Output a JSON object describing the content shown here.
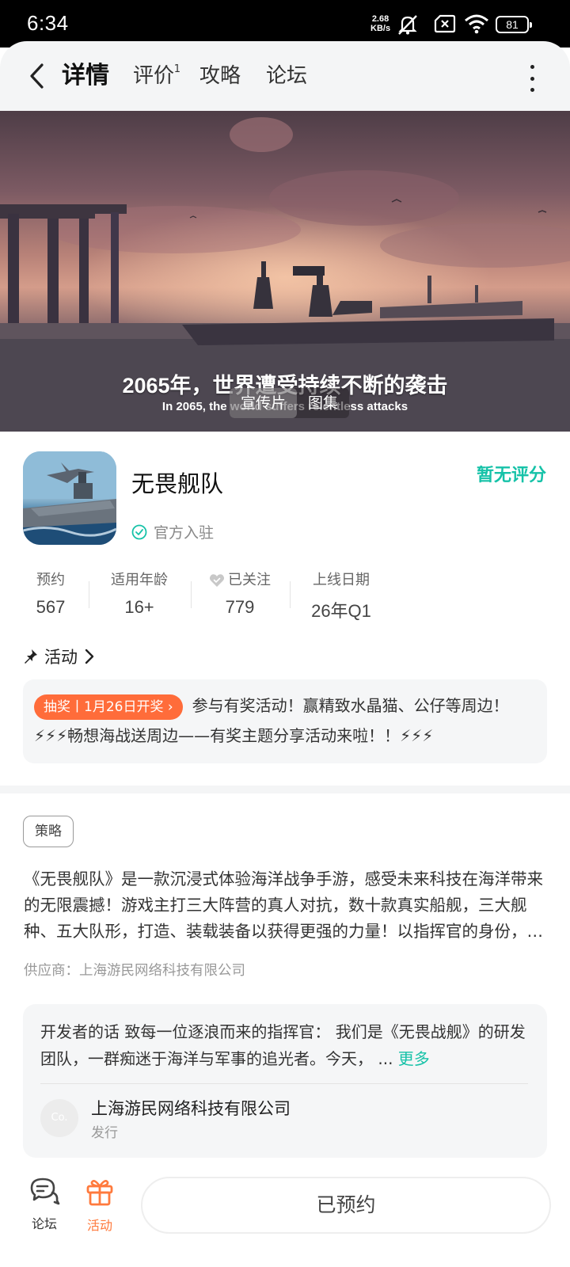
{
  "status_bar": {
    "time": "6:34",
    "net_speed_value": "2.68",
    "net_speed_unit": "KB/s",
    "battery": "81"
  },
  "header": {
    "tabs": [
      {
        "label": "详情",
        "active": true
      },
      {
        "label": "评价",
        "badge": "1"
      },
      {
        "label": "攻略"
      },
      {
        "label": "论坛"
      }
    ]
  },
  "hero": {
    "subtitle_zh": "2065年，世界遭受持续不断的袭击",
    "subtitle_en": "In 2065, the world suffers relentless attacks",
    "media_tabs": [
      "宣传片",
      "图集"
    ]
  },
  "game": {
    "name": "无畏舰队",
    "official_label": "官方入驻",
    "rating_text": "暂无评分"
  },
  "stats": [
    {
      "label": "预约",
      "value": "567"
    },
    {
      "label": "适用年龄",
      "value": "16+"
    },
    {
      "label": "已关注",
      "value": "779",
      "icon": "heart-icon"
    },
    {
      "label": "上线日期",
      "value": "26年Q1"
    }
  ],
  "activity": {
    "title": "活动",
    "badge": "抽奖丨1月26日开奖 ›",
    "text": "参与有奖活动！赢精致水晶猫、公仔等周边！ ⚡⚡⚡畅想海战送周边——有奖主题分享活动来啦！！⚡⚡⚡"
  },
  "description": {
    "tag": "策略",
    "text": "《无畏舰队》是一款沉浸式体验海洋战争手游，感受未来科技在海洋带来的无限震撼！游戏主打三大阵营的真人对抗，数十款真实船舰，三大舰种、五大队形，打造、装载装备以获得更强的力量！以指挥官的身份，带领你的舰队征战四方！",
    "supplier": "供应商：上海游民网络科技有限公司"
  },
  "developer": {
    "text": "开发者的话  致每一位逐浪而来的指挥官：  我们是《无畏战舰》的研发团队，一群痴迷于海洋与军事的追光者。今天，",
    "ellipsis": "...",
    "more": "更多",
    "avatar_text": "Co.",
    "company": "上海游民网络科技有限公司",
    "role": "发行"
  },
  "bottom_bar": {
    "forum_label": "论坛",
    "activity_label": "活动",
    "reserve_label": "已预约"
  },
  "colors": {
    "accent": "#16c2a8",
    "tab_underline": "#1fd1b8",
    "lottery_badge": "#ff6c3a",
    "activity_icon": "#ff7a3d"
  }
}
